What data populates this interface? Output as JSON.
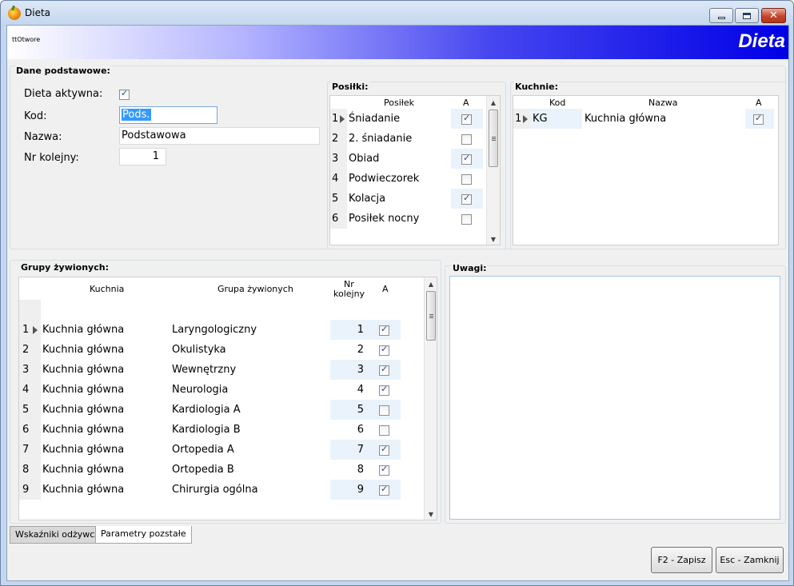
{
  "window": {
    "title": "Dieta"
  },
  "banner": {
    "left_text": "ttOtwore",
    "title": "Dieta"
  },
  "basic": {
    "label": "Dane podstawowe:",
    "active_label": "Dieta aktywna:",
    "active_checked": true,
    "code_label": "Kod:",
    "code_value": "Pods.",
    "name_label": "Nazwa:",
    "name_value": "Podstawowa",
    "order_label": "Nr kolejny:",
    "order_value": "1"
  },
  "meals": {
    "label": "Posiłki:",
    "col_meal": "Posiłek",
    "col_a": "A",
    "rows": [
      {
        "n": "1",
        "name": "Śniadanie",
        "checked": true
      },
      {
        "n": "2",
        "name": "2. śniadanie",
        "checked": false
      },
      {
        "n": "3",
        "name": "Obiad",
        "checked": true
      },
      {
        "n": "4",
        "name": "Podwieczorek",
        "checked": false
      },
      {
        "n": "5",
        "name": "Kolacja",
        "checked": true
      },
      {
        "n": "6",
        "name": "Posiłek nocny",
        "checked": false
      }
    ]
  },
  "kitchens": {
    "label": "Kuchnie:",
    "col_code": "Kod",
    "col_name": "Nazwa",
    "col_a": "A",
    "rows": [
      {
        "n": "1",
        "code": "KG",
        "name": "Kuchnia główna",
        "checked": true
      }
    ]
  },
  "groups": {
    "label": "Grupy żywionych:",
    "col_kitchen": "Kuchnia",
    "col_group": "Grupa żywionych",
    "col_order_1": "Nr",
    "col_order_2": "kolejny",
    "col_a": "A",
    "rows": [
      {
        "n": "1",
        "kitchen": "Kuchnia główna",
        "group": "Laryngologiczny",
        "order": "1",
        "checked": true
      },
      {
        "n": "2",
        "kitchen": "Kuchnia główna",
        "group": "Okulistyka",
        "order": "2",
        "checked": true
      },
      {
        "n": "3",
        "kitchen": "Kuchnia główna",
        "group": "Wewnętrzny",
        "order": "3",
        "checked": true
      },
      {
        "n": "4",
        "kitchen": "Kuchnia główna",
        "group": "Neurologia",
        "order": "4",
        "checked": true
      },
      {
        "n": "5",
        "kitchen": "Kuchnia główna",
        "group": "Kardiologia A",
        "order": "5",
        "checked": false
      },
      {
        "n": "6",
        "kitchen": "Kuchnia główna",
        "group": "Kardiologia B",
        "order": "6",
        "checked": false
      },
      {
        "n": "7",
        "kitchen": "Kuchnia główna",
        "group": "Ortopedia A",
        "order": "7",
        "checked": true
      },
      {
        "n": "8",
        "kitchen": "Kuchnia główna",
        "group": "Ortopedia B",
        "order": "8",
        "checked": true
      },
      {
        "n": "9",
        "kitchen": "Kuchnia główna",
        "group": "Chirurgia ogólna",
        "order": "9",
        "checked": true
      }
    ]
  },
  "notes": {
    "label": "Uwagi:",
    "value": ""
  },
  "tabs": [
    {
      "label": "Wskaźniki odżywcze",
      "active": false
    },
    {
      "label": "Parametry pozstałe",
      "active": true
    }
  ],
  "buttons": {
    "save": "F2 - Zapisz",
    "close": "Esc - Zamknij"
  }
}
